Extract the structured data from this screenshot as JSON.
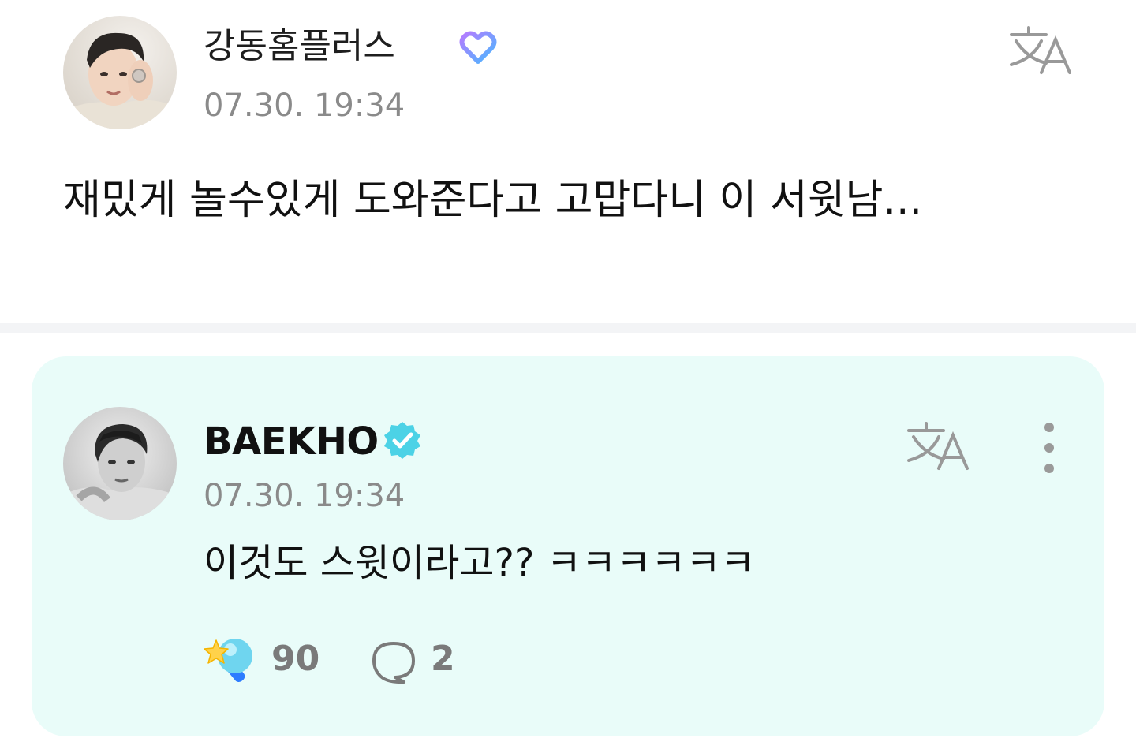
{
  "post": {
    "author": "강동홈플러스",
    "time": "07.30. 19:34",
    "text": "재밌게 놀수있게 도와준다고 고맙다니 이 서윗남...",
    "badge_icon": "fan-heart-badge-icon",
    "translate_icon": "translate-icon"
  },
  "reply": {
    "author": "BAEKHO",
    "time": "07.30. 19:34",
    "text": "이것도 스윗이라고?? ㅋㅋㅋㅋㅋㅋ",
    "verified_icon": "verified-badge-icon",
    "translate_icon": "translate-icon",
    "more_icon": "more-vertical-icon",
    "cheer_count": "90",
    "comment_count": "2",
    "background": "#e9fcf9",
    "accent": "#4cd2e6"
  }
}
